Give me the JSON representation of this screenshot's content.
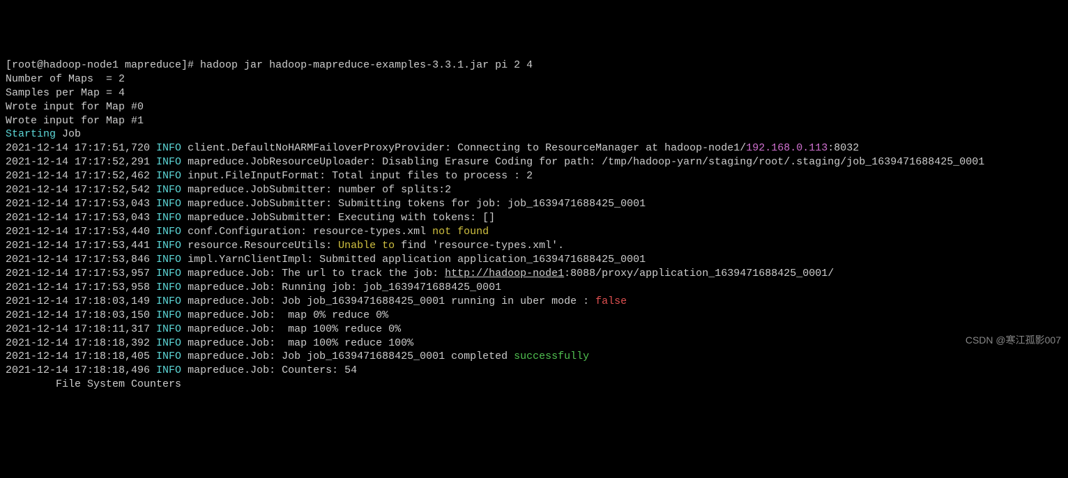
{
  "prompt": "[root@hadoop-node1 mapreduce]# ",
  "command": "hadoop jar hadoop-mapreduce-examples-3.3.1.jar pi 2 4",
  "pre_lines": [
    "Number of Maps  = 2",
    "Samples per Map = 4",
    "Wrote input for Map #0",
    "Wrote input for Map #1"
  ],
  "start": {
    "a": "Starting",
    "b": " Job"
  },
  "logs": [
    {
      "ts": "2021-12-14 17:17:51,720",
      "lvl": "INFO",
      "msg_a": " client.DefaultNoHARMFailoverProxyProvider: Connecting to ResourceManager at hadoop-node1/",
      "ip": "192.168.0.113",
      "msg_b": ":8032"
    },
    {
      "ts": "2021-12-14 17:17:52,291",
      "lvl": "INFO",
      "msg": " mapreduce.JobResourceUploader: Disabling Erasure Coding for path: /tmp/hadoop-yarn/staging/root/.staging/job_1639471688425_0001",
      "wrap": true
    },
    {
      "ts": "2021-12-14 17:17:52,462",
      "lvl": "INFO",
      "msg": " input.FileInputFormat: Total input files to process : 2"
    },
    {
      "ts": "2021-12-14 17:17:52,542",
      "lvl": "INFO",
      "msg": " mapreduce.JobSubmitter: number of splits:2"
    },
    {
      "ts": "2021-12-14 17:17:53,043",
      "lvl": "INFO",
      "msg": " mapreduce.JobSubmitter: Submitting tokens for job: job_1639471688425_0001"
    },
    {
      "ts": "2021-12-14 17:17:53,043",
      "lvl": "INFO",
      "msg": " mapreduce.JobSubmitter: Executing with tokens: []"
    },
    {
      "ts": "2021-12-14 17:17:53,440",
      "lvl": "INFO",
      "msg_a": " conf.Configuration: resource-types.xml ",
      "hl": "not found",
      "hl_class": "yellow"
    },
    {
      "ts": "2021-12-14 17:17:53,441",
      "lvl": "INFO",
      "msg_a": " resource.ResourceUtils: ",
      "hl": "Unable to",
      "hl_class": "yellow",
      "msg_b": " find 'resource-types.xml'."
    },
    {
      "ts": "2021-12-14 17:17:53,846",
      "lvl": "INFO",
      "msg": " impl.YarnClientImpl: Submitted application application_1639471688425_0001"
    },
    {
      "ts": "2021-12-14 17:17:53,957",
      "lvl": "INFO",
      "msg_a": " mapreduce.Job: The url to track the job: ",
      "url": "http://hadoop-node1",
      "msg_b": ":8088/proxy/application_1639471688425_0001/"
    },
    {
      "ts": "2021-12-14 17:17:53,958",
      "lvl": "INFO",
      "msg": " mapreduce.Job: Running job: job_1639471688425_0001"
    },
    {
      "ts": "2021-12-14 17:18:03,149",
      "lvl": "INFO",
      "msg_a": " mapreduce.Job: Job job_1639471688425_0001 running in uber mode : ",
      "hl": "false",
      "hl_class": "red"
    },
    {
      "ts": "2021-12-14 17:18:03,150",
      "lvl": "INFO",
      "msg": " mapreduce.Job:  map 0% reduce 0%"
    },
    {
      "ts": "2021-12-14 17:18:11,317",
      "lvl": "INFO",
      "msg": " mapreduce.Job:  map 100% reduce 0%"
    },
    {
      "ts": "2021-12-14 17:18:18,392",
      "lvl": "INFO",
      "msg": " mapreduce.Job:  map 100% reduce 100%"
    },
    {
      "ts": "2021-12-14 17:18:18,405",
      "lvl": "INFO",
      "msg_a": " mapreduce.Job: Job job_1639471688425_0001 completed ",
      "hl": "successfully",
      "hl_class": "green"
    },
    {
      "ts": "2021-12-14 17:18:18,496",
      "lvl": "INFO",
      "msg": " mapreduce.Job: Counters: 54"
    }
  ],
  "tail": "        File System Counters",
  "watermark": "CSDN @寒江孤影007"
}
